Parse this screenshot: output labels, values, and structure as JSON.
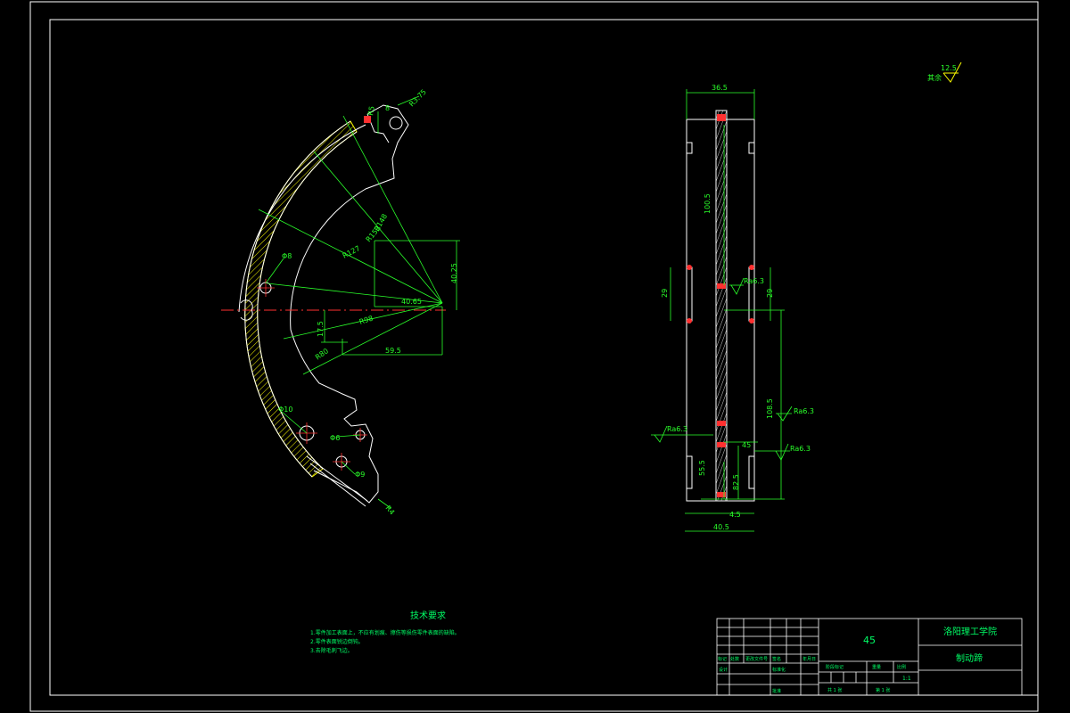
{
  "drawing": {
    "surface_finish": {
      "value": "12.5",
      "note": "其余"
    },
    "left_view": {
      "dims": {
        "d_r_top": "R3.75",
        "d_r5": "R5",
        "d_8": "8",
        "d_r148": "R148",
        "d_r152": "R152",
        "d_r127": "R127",
        "d_phi8": "Φ8",
        "d_40_65": "40.65",
        "d_40_25": "40.25",
        "d_17_5": "17.5",
        "d_r98": "R98",
        "d_r80": "R80",
        "d_59_5": "59.5",
        "d_phi10": "Φ10",
        "d_phi6": "Φ6",
        "d_phi9": "Φ9",
        "d_r4": "R4"
      }
    },
    "right_view": {
      "dims": {
        "d_36_5": "36.5",
        "d_100_5": "100.5",
        "d_29_left": "29",
        "d_29_right": "29",
        "d_108_5": "108.5",
        "d_45": "45",
        "d_55_5": "55.5",
        "d_82_5": "82.5",
        "d_4_5": "4.5",
        "d_40_5": "40.5"
      },
      "roughness": [
        "Ra6.3",
        "Ra6.3",
        "Ra6.3",
        "Ra6.3"
      ]
    },
    "tech_req": {
      "title": "技术要求",
      "items": [
        "1.零件加工表面上，不应有划痕、擦伤等损伤零件表面的缺陷。",
        "2.零件表面锐边倒钝。",
        "3.去除毛刺飞边。"
      ]
    },
    "title_block": {
      "material": "45",
      "school": "洛阳理工学院",
      "part_name": "制动蹄",
      "scale": "1:1",
      "cells": {
        "mark": "标记",
        "count": "处数",
        "zone": "分区",
        "change_doc": "更改文件号",
        "signature": "签名",
        "date": "年月日",
        "design": "设计",
        "standard": "标准化",
        "stage_mark": "阶段标记",
        "weight": "重量",
        "scale_label": "比例",
        "approve": "批准",
        "sheets_total": "共 1 张",
        "sheet_no": "第 1 张"
      }
    }
  }
}
